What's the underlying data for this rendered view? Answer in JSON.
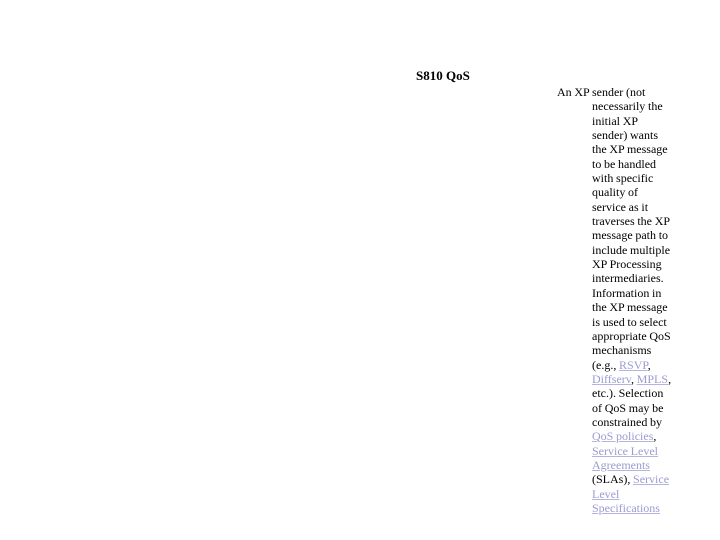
{
  "slide": {
    "title": "S810 QoS",
    "body_segments": [
      {
        "type": "text",
        "value": "An XP sender (not necessarily the initial XP sender) wants the XP message to be handled with specific quality of service as it traverses the XP message path to include multiple XP Processing intermediaries. Information in the XP message is used to select appropriate QoS mechanisms (e.g., "
      },
      {
        "type": "link",
        "value": "RSVP"
      },
      {
        "type": "text",
        "value": ", "
      },
      {
        "type": "link",
        "value": "Diffserv"
      },
      {
        "type": "text",
        "value": ", "
      },
      {
        "type": "link",
        "value": "MPLS"
      },
      {
        "type": "text",
        "value": ", etc.). Selection of QoS may be constrained by "
      },
      {
        "type": "link",
        "value": "QoS policies"
      },
      {
        "type": "text",
        "value": ", "
      },
      {
        "type": "link",
        "value": "Service Level Agreements"
      },
      {
        "type": "text",
        "value": " (SLAs), "
      },
      {
        "type": "link",
        "value": "Service Level Specifications"
      }
    ],
    "links": [
      "RSVP",
      "Diffserv",
      "MPLS",
      "QoS policies",
      "Service Level Agreements",
      "Service Level Specifications"
    ],
    "colors": {
      "background": "#ffffff",
      "text": "#000000",
      "link": "#9b9bd0",
      "link_underline": "#b4b4e0"
    }
  }
}
